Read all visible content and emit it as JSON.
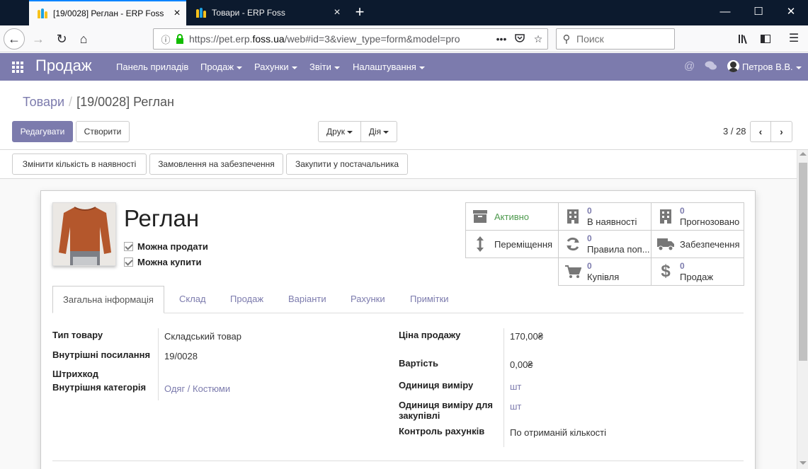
{
  "browser": {
    "tabs": [
      {
        "title": "[19/0028] Реглан - ERP Foss",
        "active": true
      },
      {
        "title": "Товари - ERP Foss",
        "active": false
      }
    ],
    "url": {
      "host_prefix": "https://pet.erp.",
      "host_domain": "foss.ua",
      "path": "/web#id=3&view_type=form&model=pro"
    },
    "search_placeholder": "Поиск"
  },
  "odoo": {
    "app_name": "Продаж",
    "menu": [
      {
        "label": "Панель приладів",
        "dropdown": false
      },
      {
        "label": "Продаж",
        "dropdown": true
      },
      {
        "label": "Рахунки",
        "dropdown": true
      },
      {
        "label": "Звіти",
        "dropdown": true
      },
      {
        "label": "Налаштування",
        "dropdown": true
      }
    ],
    "user": "Петров В.В."
  },
  "control": {
    "breadcrumb_parent": "Товари",
    "breadcrumb_separator": "/",
    "breadcrumb_current": "[19/0028] Реглан",
    "edit_label": "Редагувати",
    "create_label": "Створити",
    "print_label": "Друк",
    "action_label": "Дія",
    "pager": "3 / 28"
  },
  "statusbar": {
    "buttons": [
      "Змінити кількість в наявності",
      "Замовлення на забезпечення",
      "Закупити у постачальника"
    ]
  },
  "product": {
    "name": "Реглан",
    "can_sell_label": "Можна продати",
    "can_purchase_label": "Можна купити",
    "can_sell": true,
    "can_purchase": true
  },
  "smart_buttons": {
    "active": {
      "label": "Активно",
      "color": "#4e9a4e"
    },
    "on_hand": {
      "value": "0",
      "label": "В наявності"
    },
    "forecast": {
      "value": "0",
      "label": "Прогнозовано"
    },
    "moves": {
      "label": "Переміщення"
    },
    "rules": {
      "value": "0",
      "label": "Правила поп..."
    },
    "supply": {
      "label": "Забезпечення"
    },
    "purchases": {
      "value": "0",
      "label": "Купівля"
    },
    "sales": {
      "value": "0",
      "label": "Продаж"
    }
  },
  "form_tabs": [
    "Загальна інформація",
    "Склад",
    "Продаж",
    "Варіанти",
    "Рахунки",
    "Примітки"
  ],
  "general": {
    "product_type_label": "Тип товару",
    "product_type": "Складський товар",
    "internal_ref_label": "Внутрішні посилання",
    "internal_ref": "19/0028",
    "barcode_label": "Штрихкод",
    "barcode": "",
    "category_label": "Внутрішня категорія",
    "category": "Одяг / Костюми",
    "sale_price_label": "Ціна продажу",
    "sale_price": "170,00₴",
    "cost_label": "Вартість",
    "cost": "0,00₴",
    "uom_label": "Одиниця виміру",
    "uom": "шт",
    "purchase_uom_label_1": "Одиниця виміру для",
    "purchase_uom_label_2": "закупівлі",
    "purchase_uom": "шт",
    "invoice_policy_label": "Контроль рахунків",
    "invoice_policy": "По отриманій кількості"
  },
  "colors": {
    "brand": "#7c7bad",
    "browser_dark": "#0c1a2e"
  }
}
